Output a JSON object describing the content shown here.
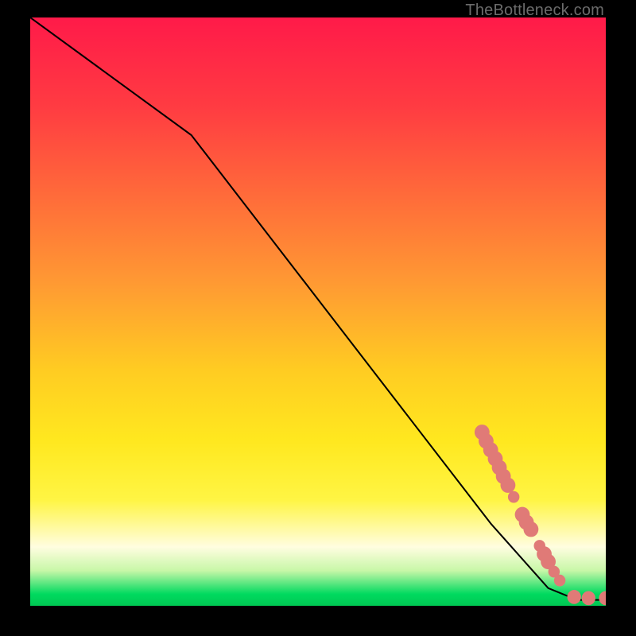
{
  "watermark": "TheBottleneck.com",
  "chart_data": {
    "type": "line",
    "title": "",
    "xlabel": "",
    "ylabel": "",
    "xlim": [
      0,
      100
    ],
    "ylim": [
      0,
      100
    ],
    "grid": false,
    "legend": false,
    "background": "rainbow-vertical",
    "series": [
      {
        "name": "curve",
        "color": "#000000",
        "x": [
          0,
          28,
          80,
          90,
          95,
          100
        ],
        "y": [
          100,
          80,
          14,
          3,
          1,
          1
        ]
      }
    ],
    "markers": [
      {
        "name": "dots",
        "color": "#e07a77",
        "shape": "circle",
        "points": [
          {
            "x": 78.5,
            "y": 29.5,
            "r": 1.3
          },
          {
            "x": 79.2,
            "y": 28.0,
            "r": 1.3
          },
          {
            "x": 80.0,
            "y": 26.5,
            "r": 1.3
          },
          {
            "x": 80.8,
            "y": 25.0,
            "r": 1.3
          },
          {
            "x": 81.5,
            "y": 23.5,
            "r": 1.3
          },
          {
            "x": 82.2,
            "y": 22.0,
            "r": 1.3
          },
          {
            "x": 83.0,
            "y": 20.5,
            "r": 1.3
          },
          {
            "x": 84.0,
            "y": 18.5,
            "r": 1.0
          },
          {
            "x": 85.5,
            "y": 15.5,
            "r": 1.3
          },
          {
            "x": 86.2,
            "y": 14.2,
            "r": 1.3
          },
          {
            "x": 87.0,
            "y": 13.0,
            "r": 1.3
          },
          {
            "x": 88.5,
            "y": 10.2,
            "r": 1.0
          },
          {
            "x": 89.3,
            "y": 8.8,
            "r": 1.3
          },
          {
            "x": 90.0,
            "y": 7.5,
            "r": 1.3
          },
          {
            "x": 91.0,
            "y": 5.8,
            "r": 1.0
          },
          {
            "x": 92.0,
            "y": 4.3,
            "r": 1.0
          },
          {
            "x": 94.5,
            "y": 1.5,
            "r": 1.2
          },
          {
            "x": 97.0,
            "y": 1.3,
            "r": 1.2
          },
          {
            "x": 100.0,
            "y": 1.3,
            "r": 1.2
          }
        ]
      }
    ]
  }
}
